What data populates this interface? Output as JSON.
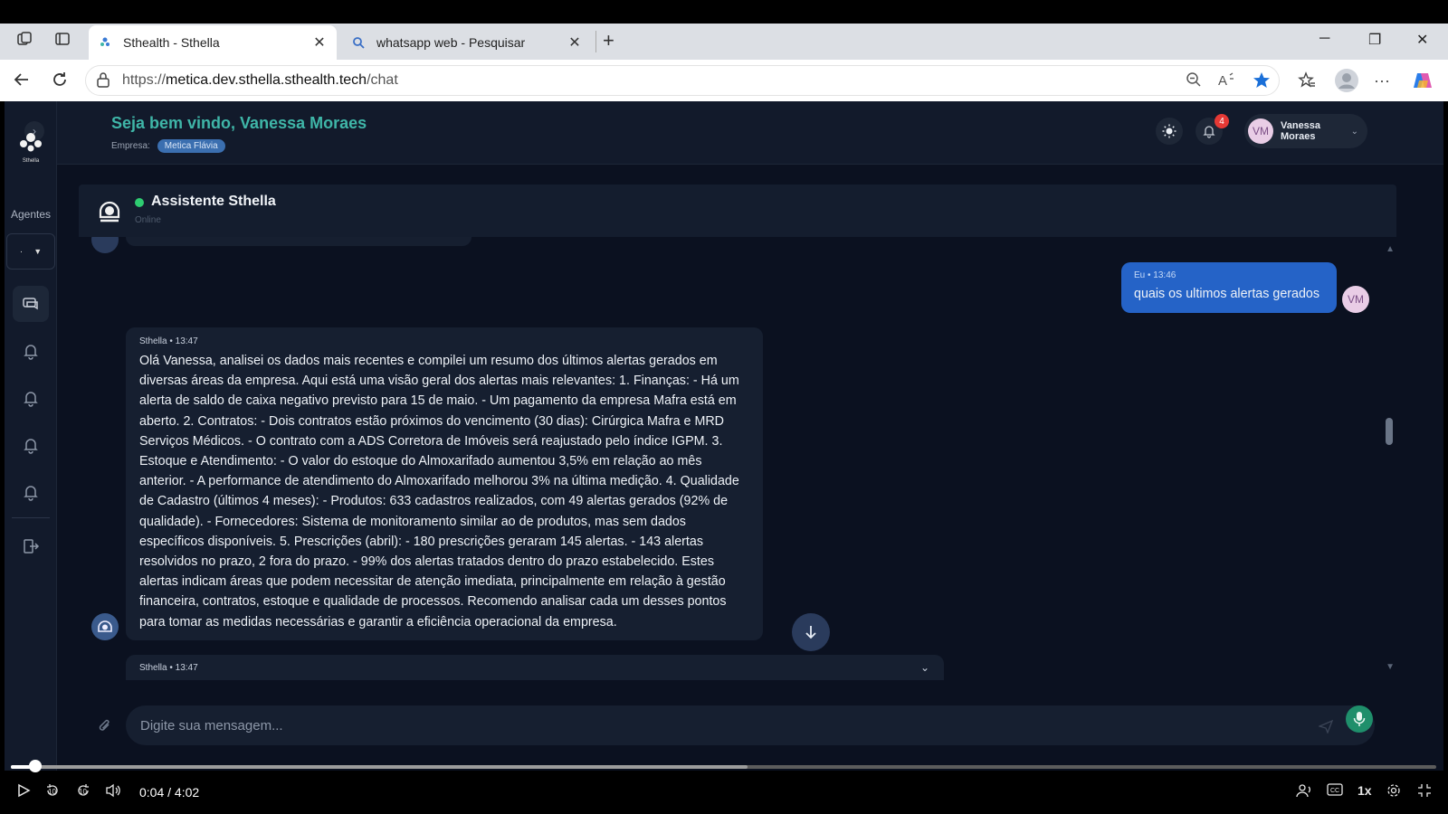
{
  "browser": {
    "tabs": [
      {
        "title": "Sthealth - Sthella"
      },
      {
        "title": "whatsapp web - Pesquisar"
      }
    ],
    "url_protocol": "https://",
    "url_host": "metica.dev.sthella.sthealth.tech",
    "url_path": "/chat"
  },
  "sidebar": {
    "logo_text": "Sthella",
    "agents_label": "Agentes",
    "agents_value": "·"
  },
  "header": {
    "welcome_prefix": "Seja bem vindo, ",
    "user_name": "Vanessa Moraes",
    "company_label": "Empresa:",
    "company_value": "Metica Flávia",
    "notification_count": "4",
    "avatar_initials": "VM",
    "user_display": "Vanessa Moraes"
  },
  "chat": {
    "assistant_name": "Assistente Sthella",
    "assistant_status": "Online",
    "messages": [
      {
        "meta": "Eu • 13:46",
        "text": "quais os ultimos alertas gerados",
        "avatar": "VM"
      },
      {
        "meta": "Sthella • 13:47",
        "text": "Olá Vanessa, analisei os dados mais recentes e compilei um resumo dos últimos alertas gerados em diversas áreas da empresa. Aqui está uma visão geral dos alertas mais relevantes: 1. Finanças: - Há um alerta de saldo de caixa negativo previsto para 15 de maio. - Um pagamento da empresa Mafra está em aberto. 2. Contratos: - Dois contratos estão próximos do vencimento (30 dias): Cirúrgica Mafra e MRD Serviços Médicos. - O contrato com a ADS Corretora de Imóveis será reajustado pelo índice IGPM. 3. Estoque e Atendimento: - O valor do estoque do Almoxarifado aumentou 3,5% em relação ao mês anterior. - A performance de atendimento do Almoxarifado melhorou 3% na última medição. 4. Qualidade de Cadastro (últimos 4 meses): - Produtos: 633 cadastros realizados, com 49 alertas gerados (92% de qualidade). - Fornecedores: Sistema de monitoramento similar ao de produtos, mas sem dados específicos disponíveis. 5. Prescrições (abril): - 180 prescrições geraram 145 alertas. - 143 alertas resolvidos no prazo, 2 fora do prazo. - 99% dos alertas tratados dentro do prazo estabelecido. Estes alertas indicam áreas que podem necessitar de atenção imediata, principalmente em relação à gestão financeira, contratos, estoque e qualidade de processos. Recomendo analisar cada um desses pontos para tomar as medidas necessárias e garantir a eficiência operacional da empresa."
      },
      {
        "meta": "Sthella • 13:47"
      }
    ],
    "input_placeholder": "Digite sua mensagem..."
  },
  "video": {
    "progress_fraction": 0.017,
    "buffer_fraction": 0.517,
    "time": "0:04 / 4:02",
    "speed": "1x",
    "skip_back": "10",
    "skip_forward": "10"
  }
}
